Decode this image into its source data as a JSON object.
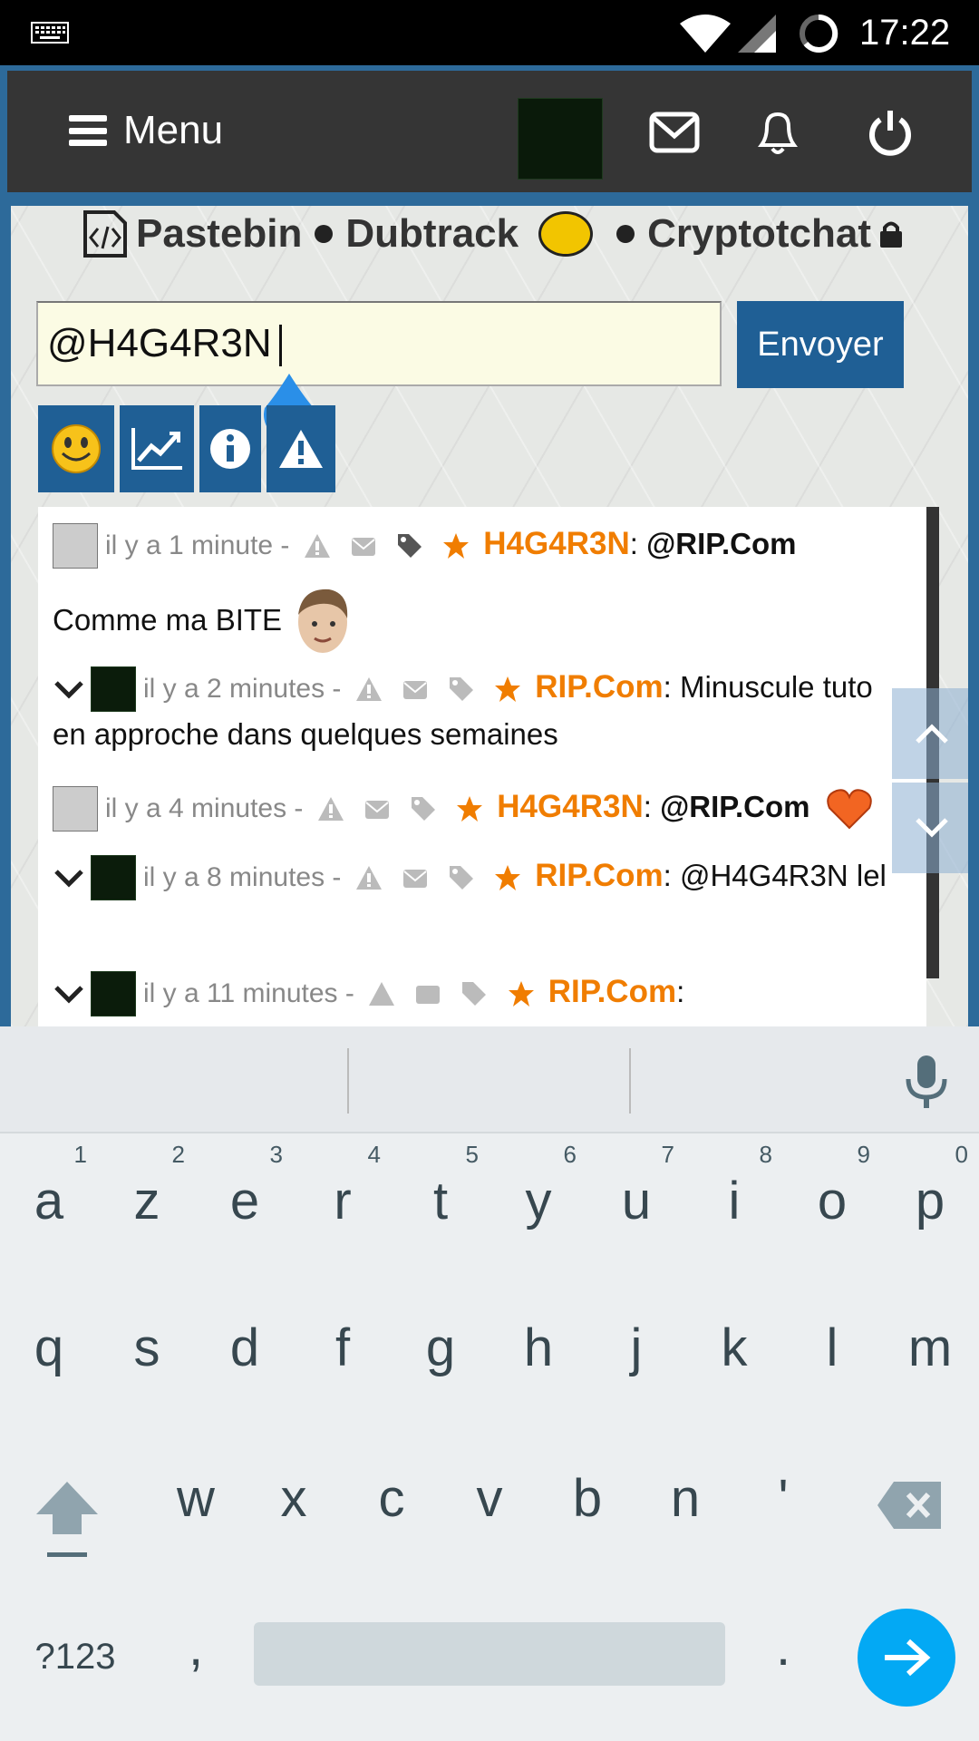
{
  "status_bar": {
    "time": "17:22"
  },
  "app": {
    "menu_label": "Menu",
    "icons": [
      "mail-icon",
      "bell-icon",
      "power-icon"
    ],
    "links": {
      "pastebin": "Pastebin",
      "dubtrack": "Dubtrack",
      "cryptotchat": "Cryptotchat"
    }
  },
  "compose": {
    "value": "@H4G4R3N",
    "send_label": "Envoyer"
  },
  "toolbar": [
    "smiley-icon",
    "chart-icon",
    "info-icon",
    "warning-icon"
  ],
  "messages": [
    {
      "time": "il y a 1 minute -",
      "user": "H4G4R3N",
      "sep": ":",
      "mention": "@RIP.Com",
      "text": "Comme ma BITE"
    },
    {
      "time": "il y a 2 minutes -",
      "user": "RIP.Com",
      "sep": ":",
      "text": "Minuscule tuto en approche dans quelques semaines"
    },
    {
      "time": "il y a 4 minutes -",
      "user": "H4G4R3N",
      "sep": ":",
      "mention": "@RIP.Com"
    },
    {
      "time": "il y a 8 minutes -",
      "user": "RIP.Com",
      "sep": ":",
      "text": "@H4G4R3N lel"
    },
    {
      "time": "il y a 11 minutes -",
      "user": "RIP.Com",
      "sep": ":"
    }
  ],
  "keyboard": {
    "row1": [
      {
        "k": "a",
        "h": "1"
      },
      {
        "k": "z",
        "h": "2"
      },
      {
        "k": "e",
        "h": "3"
      },
      {
        "k": "r",
        "h": "4"
      },
      {
        "k": "t",
        "h": "5"
      },
      {
        "k": "y",
        "h": "6"
      },
      {
        "k": "u",
        "h": "7"
      },
      {
        "k": "i",
        "h": "8"
      },
      {
        "k": "o",
        "h": "9"
      },
      {
        "k": "p",
        "h": "0"
      }
    ],
    "row2": [
      "q",
      "s",
      "d",
      "f",
      "g",
      "h",
      "j",
      "k",
      "l",
      "m"
    ],
    "row3": [
      "w",
      "x",
      "c",
      "v",
      "b",
      "n",
      "'"
    ],
    "symbols": "?123",
    "comma": ",",
    "period": "."
  }
}
